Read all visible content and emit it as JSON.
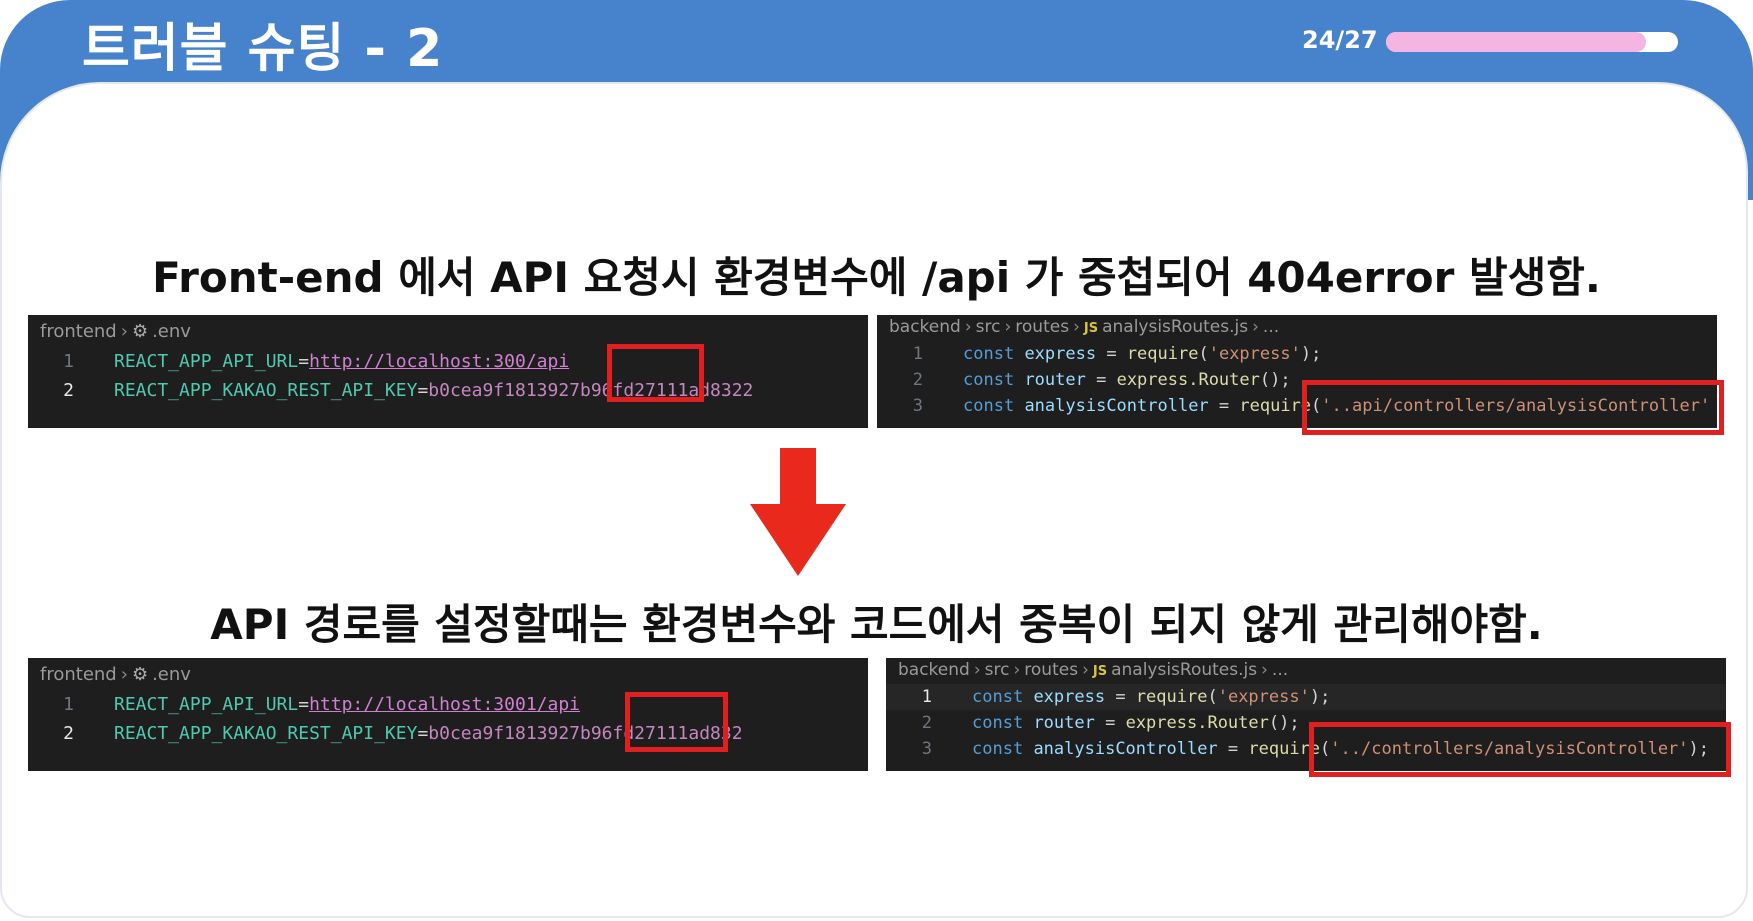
{
  "header": {
    "title": "트러블 슈팅 - 2",
    "page_indicator": "24/27",
    "progress": 0.889
  },
  "problem_text": "Front-end 에서 API 요청시 환경변수에 /api 가 중첩되어 404error 발생함.",
  "solution_text": "API 경로를 설정할때는 환경변수와 코드에서 중복이 되지 않게 관리해야함.",
  "env_panel": {
    "breadcrumb": [
      "frontend",
      ".env"
    ],
    "before": {
      "lines": [
        {
          "num": "1",
          "key": "REACT_APP_API_URL",
          "value": "http://localhost:300",
          "value_tail": "/api"
        },
        {
          "num": "2",
          "key": "REACT_APP_KAKAO_REST_API_KEY",
          "value": "b0cea9f1813927b96fd27111ad8322"
        }
      ]
    },
    "after": {
      "lines": [
        {
          "num": "1",
          "key": "REACT_APP_API_URL",
          "value": "http://localhost:3001",
          "value_tail": "/api"
        },
        {
          "num": "2",
          "key": "REACT_APP_KAKAO_REST_API_KEY",
          "value": "b0cea9f1813927b96fd27111ad832"
        }
      ]
    }
  },
  "routes_panel": {
    "breadcrumb": [
      "backend",
      "src",
      "routes",
      "analysisRoutes.js",
      "..."
    ],
    "js_badge": "JS",
    "before": {
      "lines": [
        {
          "num": "1",
          "kw": "const",
          "name": "express",
          "op": " = ",
          "call": "require",
          "arg": "'express'",
          "end": ");"
        },
        {
          "num": "2",
          "kw": "const",
          "name": "router",
          "op": " = ",
          "call": "express.Router",
          "arg": "",
          "end": "();"
        },
        {
          "num": "3",
          "kw": "const",
          "name": "analysisController",
          "op": " = ",
          "call": "require",
          "arg": "'..api/controllers/analysisController'",
          "end": ""
        }
      ]
    },
    "after": {
      "lines": [
        {
          "num": "1",
          "kw": "const",
          "name": "express",
          "op": " = ",
          "call": "require",
          "arg": "'express'",
          "end": ");"
        },
        {
          "num": "2",
          "kw": "const",
          "name": "router",
          "op": " = ",
          "call": "express.Router",
          "arg": "",
          "end": "();"
        },
        {
          "num": "3",
          "kw": "const",
          "name": "analysisController",
          "op": " = ",
          "call": "require",
          "arg": "'../controllers/analysisController'",
          "end": ");"
        }
      ]
    }
  },
  "colors": {
    "header": "#4683cc",
    "progress_fill": "#f4b5e3",
    "highlight_box": "#e02020",
    "arrow": "#e8291c"
  }
}
